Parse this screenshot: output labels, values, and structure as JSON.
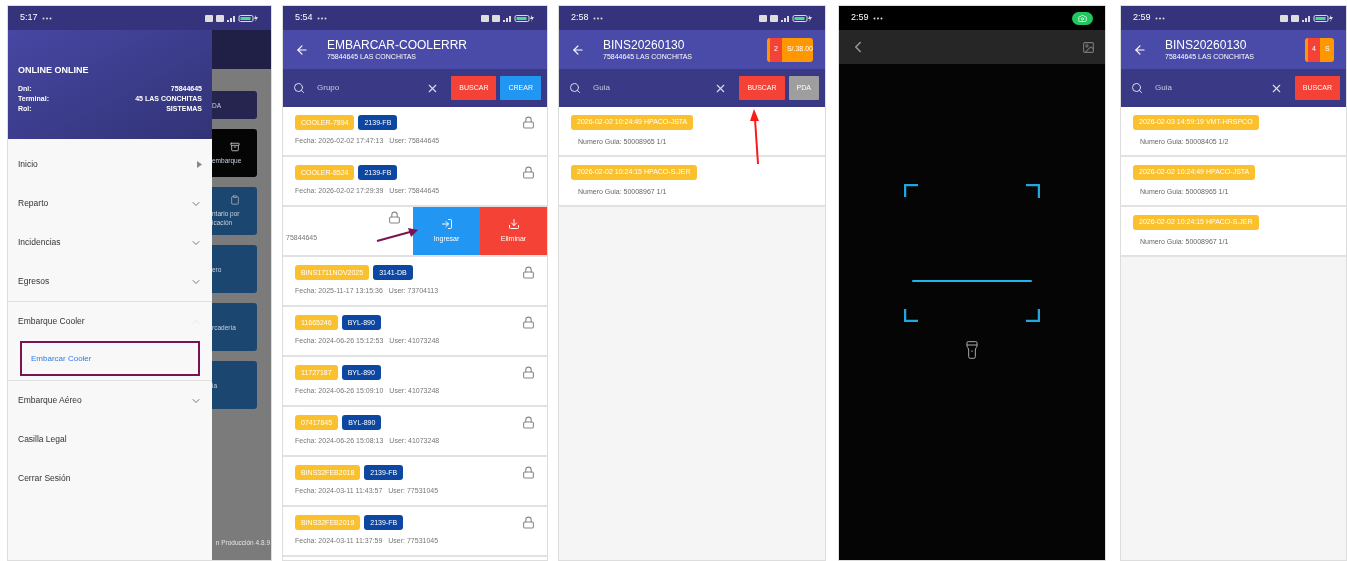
{
  "screens": [
    {
      "kind": "drawer",
      "status_time": "5:17",
      "profile": {
        "name": "ONLINE ONLINE",
        "fields": [
          {
            "label": "Dni:",
            "value": "75844645"
          },
          {
            "label": "Terminal:",
            "value": "45 LAS CONCHITAS"
          },
          {
            "label": "Rol:",
            "value": "SISTEMAS"
          }
        ]
      },
      "menu": [
        {
          "label": "Inicio",
          "kind": "arrow",
          "expanded": false
        },
        {
          "label": "Reparto",
          "kind": "chevron",
          "expanded": false
        },
        {
          "label": "Incidencias",
          "kind": "chevron",
          "expanded": false
        },
        {
          "label": "Egresos",
          "kind": "chevron",
          "expanded": false
        },
        {
          "label": "Embarque Cooler",
          "kind": "chevron",
          "expanded": true,
          "children": [
            {
              "label": "Embarcar Cooler",
              "selected": true,
              "annotated": true
            }
          ]
        },
        {
          "label": "Embarque Aéreo",
          "kind": "chevron",
          "expanded": false
        },
        {
          "label": "Casilla Legal",
          "kind": "plain",
          "expanded": false
        },
        {
          "label": "Cerrar Sesión",
          "kind": "plain",
          "expanded": false
        }
      ],
      "background_cards": [
        {
          "lines": [
            "DA"
          ],
          "color": "#25254f"
        },
        {
          "lines": [
            "embarque"
          ],
          "color": "#050505"
        },
        {
          "lines": [
            "ntario por",
            "icación"
          ],
          "color": "#1b4670"
        },
        {
          "lines": [
            "ero"
          ],
          "color": "#1b4670"
        },
        {
          "lines": [
            "rcadería"
          ],
          "color": "#1b4670"
        },
        {
          "lines": [
            "ia"
          ],
          "color": "#1b4670"
        }
      ],
      "version": "n Producción 4.8.9"
    },
    {
      "kind": "list",
      "status_time": "5:54",
      "title": "EMBARCAR-COOLERRR",
      "subtitle": "75844645 LAS CONCHITAS",
      "search_placeholder": "Grupo",
      "buttons": [
        {
          "label": "BUSCAR",
          "kind": "danger"
        },
        {
          "label": "CREAR",
          "kind": "primary"
        }
      ],
      "items": [
        {
          "tag": "COOLER-7894",
          "code": "2139-FB",
          "fecha": "Fecha: 2026-02-02 17:47:13",
          "user": "User: 75844645",
          "swiped": false
        },
        {
          "tag": "COOLER-8524",
          "code": "2139-FB",
          "fecha": "Fecha: 2026-02-02 17:29:39",
          "user": "User: 75844645",
          "swiped": false
        },
        {
          "user": "75844645",
          "swiped": true,
          "actions": [
            {
              "label": "Ingresar",
              "kind": "primary"
            },
            {
              "label": "Eliminar",
              "kind": "danger"
            }
          ]
        },
        {
          "tag": "BINS1711NOV2025",
          "code": "3141-DB",
          "fecha": "Fecha: 2025-11-17 13:15:36",
          "user": "User: 73704113",
          "swiped": false
        },
        {
          "tag": "11665246",
          "code": "BYL-890",
          "fecha": "Fecha: 2024-06-26 15:12:53",
          "user": "User: 41073248",
          "swiped": false
        },
        {
          "tag": "11727187",
          "code": "BYL-890",
          "fecha": "Fecha: 2024-06-26 15:09:10",
          "user": "User: 41073248",
          "swiped": false
        },
        {
          "tag": "07417845",
          "code": "BYL-890",
          "fecha": "Fecha: 2024-06-26 15:08:13",
          "user": "User: 41073248",
          "swiped": false
        },
        {
          "tag": "BINS32FEB2018",
          "code": "2139-FB",
          "fecha": "Fecha: 2024-03-11 11:43:57",
          "user": "User: 77531045",
          "swiped": false
        },
        {
          "tag": "BINS32FEB2019",
          "code": "2139-FB",
          "fecha": "Fecha: 2024-03-11 11:37:59",
          "user": "User: 77531045",
          "swiped": false
        }
      ],
      "annotation": {
        "kind": "arrow",
        "color": "#7a1450"
      }
    },
    {
      "kind": "guides",
      "status_time": "2:58",
      "title": "BINS20260130",
      "subtitle": "75844645 LAS CONCHITAS",
      "count": "2",
      "amount": "S/.38.00",
      "search_placeholder": "Guia",
      "buttons": [
        {
          "label": "BUSCAR",
          "kind": "danger"
        },
        {
          "label": "PDA",
          "kind": "neutral"
        }
      ],
      "items": [
        {
          "tag": "2026-02-02 10:24:49 HPACO-JSTA",
          "guia": "Numero Guia: 50008965 1/1"
        },
        {
          "tag": "2026-02-02 10:24:15 HPACO-S.JER",
          "guia": "Numero Guia: 50008967 1/1"
        }
      ],
      "annotation": {
        "kind": "arrow",
        "color": "#ff1a1a"
      }
    },
    {
      "kind": "scanner",
      "status_time": "2:59"
    },
    {
      "kind": "guides",
      "status_time": "2:59",
      "title": "BINS20260130",
      "subtitle": "75844645 LAS CONCHITAS",
      "count": "4",
      "amount": "S",
      "search_placeholder": "Guia",
      "buttons": [
        {
          "label": "BUSCAR",
          "kind": "danger"
        }
      ],
      "items": [
        {
          "tag": "2026-02-03 14:59:19 VMT-HRSPCO",
          "guia": "Numero Guia: 50008405 1/2"
        },
        {
          "tag": "2026-02-02 10:24:49 HPACO-JSTA",
          "guia": "Numero Guia: 50008965 1/1"
        },
        {
          "tag": "2026-02-02 10:24:15 HPACO-S.JER",
          "guia": "Numero Guia: 50008967 1/1"
        }
      ]
    }
  ]
}
